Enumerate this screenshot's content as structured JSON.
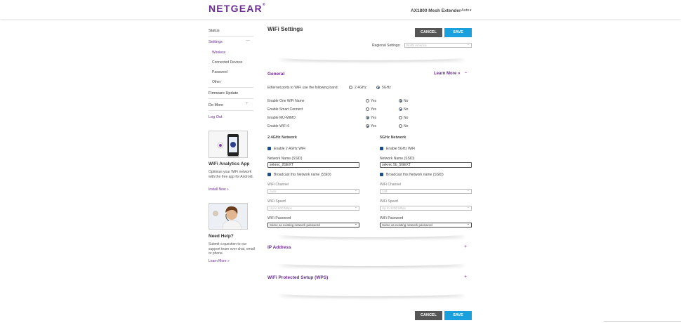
{
  "header": {
    "logo": "NETGEAR",
    "logo_reg": "®",
    "product": "AX1800 Mesh Extender",
    "language": "Auto"
  },
  "sidebar": {
    "status": "Status",
    "settings": "Settings",
    "sub_items": [
      "Wireless",
      "Connected Devices",
      "Password",
      "Other"
    ],
    "firmware": "Firmware Update",
    "do_more": "Do More",
    "logout": "Log Out",
    "analytics": {
      "title": "WiFi Analytics App",
      "text": "Optimize your WiFi network with the free app for Android.",
      "link": "Install Now »"
    },
    "help": {
      "title": "Need Help?",
      "text": "Submit a question to our support team over chat, email or phone.",
      "link": "Learn More »"
    }
  },
  "main": {
    "title": "WiFi Settings",
    "cancel": "CANCEL",
    "save": "SAVE",
    "regional_label": "Regional Settings:",
    "regional_value": "North America",
    "general": {
      "title": "General",
      "learn_more": "Learn More »",
      "ethernet_label": "Ethernet ports to WiFi use the following band:",
      "band_24": "2.4GHz",
      "band_5": "5GHz",
      "yes": "Yes",
      "no": "No",
      "rows": [
        {
          "label": "Enable One WiFi Name"
        },
        {
          "label": "Enable Smart Connect"
        },
        {
          "label": "Enable MU-MIMO"
        },
        {
          "label": "Enable WiFi 6"
        }
      ]
    },
    "net24": {
      "title": "2.4GHz Network",
      "enable": "Enable 2.4GHz WiFi",
      "ssid_label": "Network Name (SSID)",
      "ssid": "sekrec_2GEXT",
      "broadcast": "Broadcast this Network name (SSID)",
      "channel_label": "WiFi Channel",
      "channel": "Auto",
      "speed_label": "WiFi Speed",
      "speed": "Up to 600 Mbps",
      "password_label": "WiFi Password",
      "password": "Same as existing network password"
    },
    "net5": {
      "title": "5GHz Network",
      "enable": "Enable 5GHz WiFi",
      "ssid_label": "Network Name (SSID)",
      "ssid": "sekrec 5b_5GEXT",
      "broadcast": "Broadcast this Network name (SSID)",
      "channel_label": "WiFi Channel",
      "channel": "149",
      "speed_label": "WiFi Speed",
      "speed": "Up to 1200 Mbps",
      "password_label": "WiFi Password",
      "password": "Same as existing network password"
    },
    "ip_title": "IP Address",
    "wps_title": "WiFi Protected Setup (WPS)"
  },
  "colors": {
    "brand_purple": "#6a2c91",
    "save_blue": "#1aa0dd",
    "cancel_gray": "#555555"
  }
}
